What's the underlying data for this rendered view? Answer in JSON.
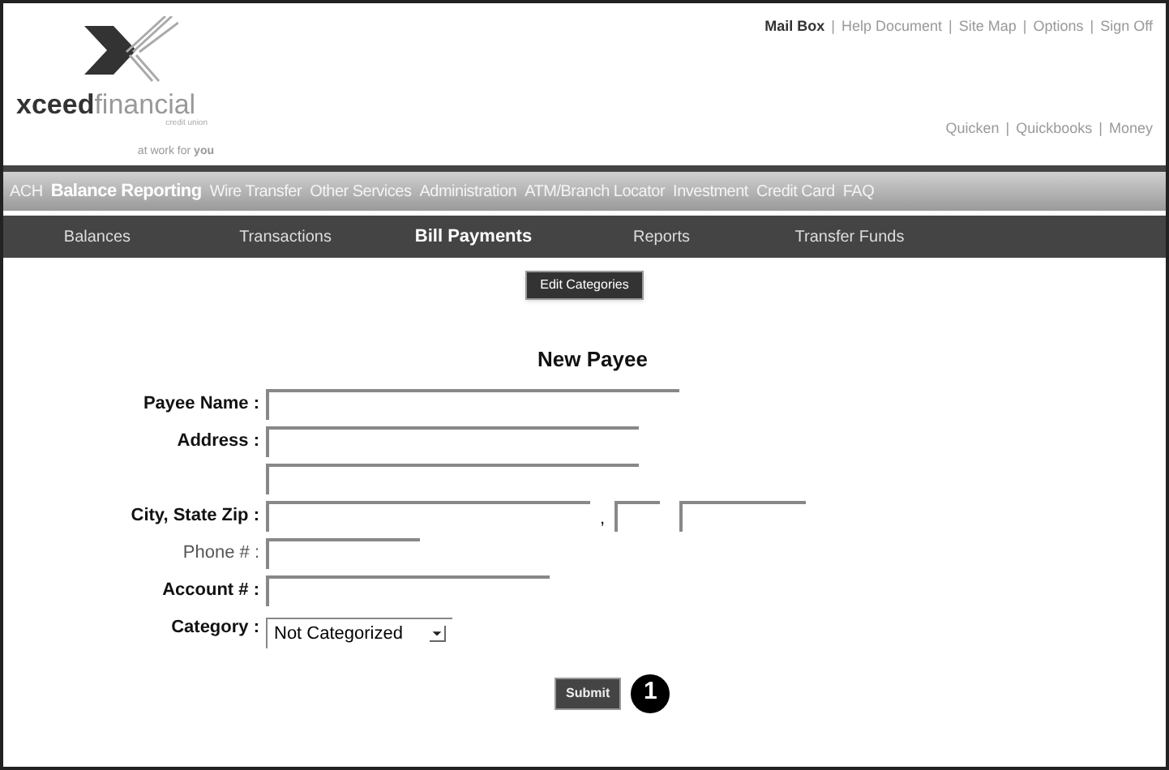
{
  "logo": {
    "wordmark": "**xceed**financial",
    "subtitle": "credit union",
    "tagline": "at work for **you**"
  },
  "link_separator": "|",
  "top_links": [
    {
      "label": "Mail Box",
      "selected": true
    },
    {
      "label": "Help Document",
      "selected": false
    },
    {
      "label": "Site Map",
      "selected": false
    },
    {
      "label": "Options",
      "selected": false
    },
    {
      "label": "Sign Off",
      "selected": false
    }
  ],
  "software_links": [
    "Quicken",
    "Quickbooks",
    "Money"
  ],
  "main_nav": [
    {
      "label": "ACH",
      "selected": false
    },
    {
      "label": "Balance Reporting",
      "selected": true
    },
    {
      "label": "Wire Transfer",
      "selected": false
    },
    {
      "label": "Other Services",
      "selected": false
    },
    {
      "label": "Administration",
      "selected": false
    },
    {
      "label": "ATM/Branch Locator",
      "selected": false
    },
    {
      "label": "Investment",
      "selected": false
    },
    {
      "label": "Credit Card",
      "selected": false
    },
    {
      "label": "FAQ",
      "selected": false
    }
  ],
  "sub_nav": [
    {
      "label": "Balances",
      "selected": false
    },
    {
      "label": "Transactions",
      "selected": false
    },
    {
      "label": "Bill Payments",
      "selected": true
    },
    {
      "label": "Reports",
      "selected": false
    },
    {
      "label": "Transfer Funds",
      "selected": false
    }
  ],
  "edit_button": "Edit Categories",
  "form": {
    "title": "New Payee",
    "rows": [
      {
        "label": "Payee Name :",
        "bold": true,
        "kind": "name"
      },
      {
        "label": "Address :",
        "bold": true,
        "kind": "address"
      },
      {
        "kind": "address"
      },
      {
        "label": "City, State Zip :",
        "bold": true,
        "kind": "city"
      },
      {
        "label": "Phone # :",
        "bold": false,
        "kind": "phone"
      },
      {
        "label": "Account # :",
        "bold": true,
        "kind": "account"
      },
      {
        "label": "Category :",
        "bold": true,
        "kind": "select",
        "value": "Not Categorized"
      }
    ],
    "city_separator": ",",
    "submit": "Submit"
  },
  "callout": "1"
}
